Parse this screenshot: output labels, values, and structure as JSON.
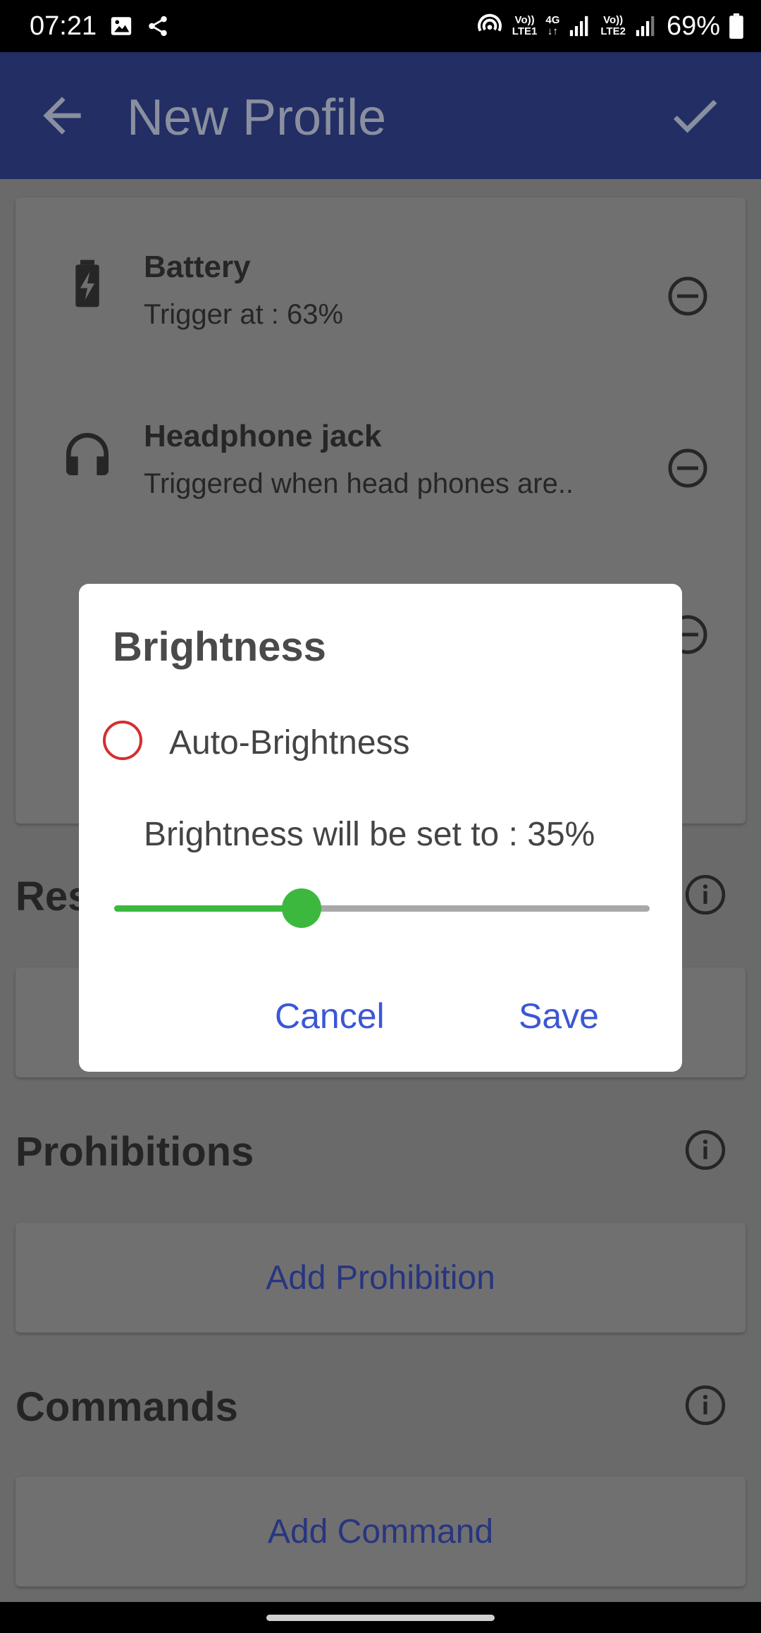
{
  "status_bar": {
    "time": "07:21",
    "network1": [
      "Vo))",
      "LTE1"
    ],
    "network_type": "4G",
    "network2": [
      "Vo))",
      "LTE2"
    ],
    "battery": "69%"
  },
  "app_bar": {
    "title": "New Profile"
  },
  "conditions": [
    {
      "title": "Battery",
      "subtitle": "Trigger at : 63%",
      "icon": "battery-charging-icon"
    },
    {
      "title": "Headphone jack",
      "subtitle": "Triggered when head phones are..",
      "icon": "headphones-icon"
    }
  ],
  "sections": {
    "restrictions_partial": "Res",
    "prohibitions": "Prohibitions",
    "commands": "Commands"
  },
  "buttons": {
    "add_prohibition": "Add Prohibition",
    "add_command": "Add Command"
  },
  "dialog": {
    "title": "Brightness",
    "auto_label": "Auto-Brightness",
    "auto_checked": false,
    "brightness_text": "Brightness will be set to : 35%",
    "slider_value": 0.35,
    "cancel_label": "Cancel",
    "save_label": "Save"
  },
  "colors": {
    "app_bar": "#222e64",
    "accent_green": "#3cb83e",
    "radio_red": "#d32f2f",
    "dialog_button": "#3b57d6"
  }
}
